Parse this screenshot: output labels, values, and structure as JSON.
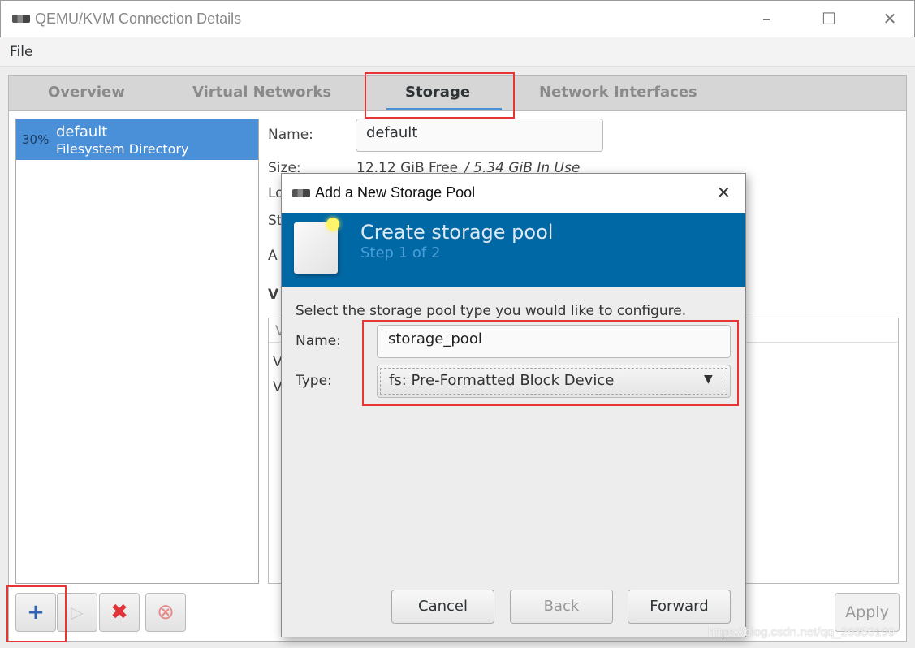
{
  "window": {
    "title": "QEMU/KVM Connection Details",
    "app_icon": "virt-manager-icon",
    "minimize": "–",
    "maximize": "☐",
    "close": "✕"
  },
  "menu": {
    "file": "File"
  },
  "tabs": [
    {
      "label": "Overview"
    },
    {
      "label": "Virtual Networks"
    },
    {
      "label": "Storage",
      "active": true
    },
    {
      "label": "Network Interfaces"
    }
  ],
  "pools": [
    {
      "usage": "30%",
      "name": "default",
      "type": "Filesystem Directory",
      "selected": true
    }
  ],
  "details": {
    "name_label": "Name:",
    "name_value": "default",
    "size_label": "Size:",
    "size_free": "12.12 GiB Free",
    "size_used": " / 5.34 GiB In Use",
    "location_label_fragment": "Lo",
    "state_label_fragment": "St",
    "autostart_label_fragment": "A",
    "volumes_heading_fragment": "V",
    "volume_col_fragment": "V",
    "volume_rows_fragments": [
      "V",
      "V"
    ]
  },
  "pool_toolbar": {
    "add": "+",
    "start": "▷",
    "delete": "✖",
    "stop": "⊗"
  },
  "apply_label": "Apply",
  "dialog": {
    "title": "Add a New Storage Pool",
    "close": "✕",
    "heading": "Create storage pool",
    "step": "Step 1 of 2",
    "instruction": "Select the storage pool type you would like to configure.",
    "name_label": "Name:",
    "name_value": "storage_pool",
    "type_label": "Type:",
    "type_value": "fs: Pre-Formatted Block Device",
    "cancel": "Cancel",
    "back": "Back",
    "forward": "Forward"
  },
  "watermark": "https://blog.csdn.net/qq_26350199",
  "colors": {
    "selection": "#4a90d9",
    "banner": "#0068a5",
    "highlight_box": "#e53535"
  }
}
